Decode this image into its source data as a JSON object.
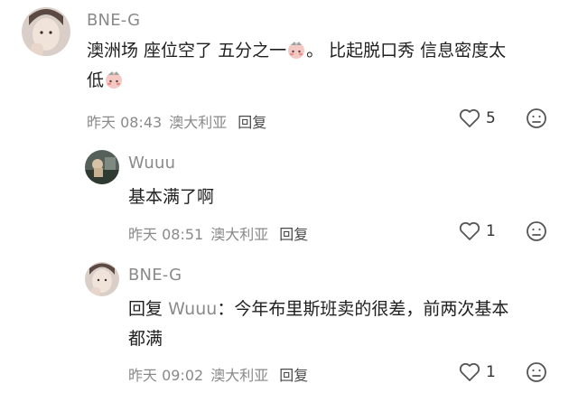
{
  "comments": [
    {
      "username": "BNE-G",
      "text_line1": "澳洲场 座位空了 五分之一",
      "text_line1b": "。 比起脱口秀 信息密度太",
      "text_line2": "低",
      "time": "昨天 08:43",
      "location": "澳大利亚",
      "reply_label": "回复",
      "likes": "5"
    },
    {
      "username": "Wuuu",
      "text": "基本满了啊",
      "time": "昨天 08:51",
      "location": "澳大利亚",
      "reply_label": "回复",
      "likes": "1"
    },
    {
      "username": "BNE-G",
      "reply_prefix": "回复",
      "reply_target": "Wuuu",
      "reply_colon": "：",
      "text_line1": "今年布里斯班卖的很差，前两次基本",
      "text_line2": "都满",
      "time": "昨天 09:02",
      "location": "澳大利亚",
      "reply_label": "回复",
      "likes": "1"
    }
  ],
  "icons": {
    "like": "heart-outline-icon",
    "dislike": "unhappy-face-icon",
    "emoji": "blushing-face-sticker"
  },
  "colors": {
    "muted": "#8a8a8a",
    "text": "#1f1f1f"
  }
}
